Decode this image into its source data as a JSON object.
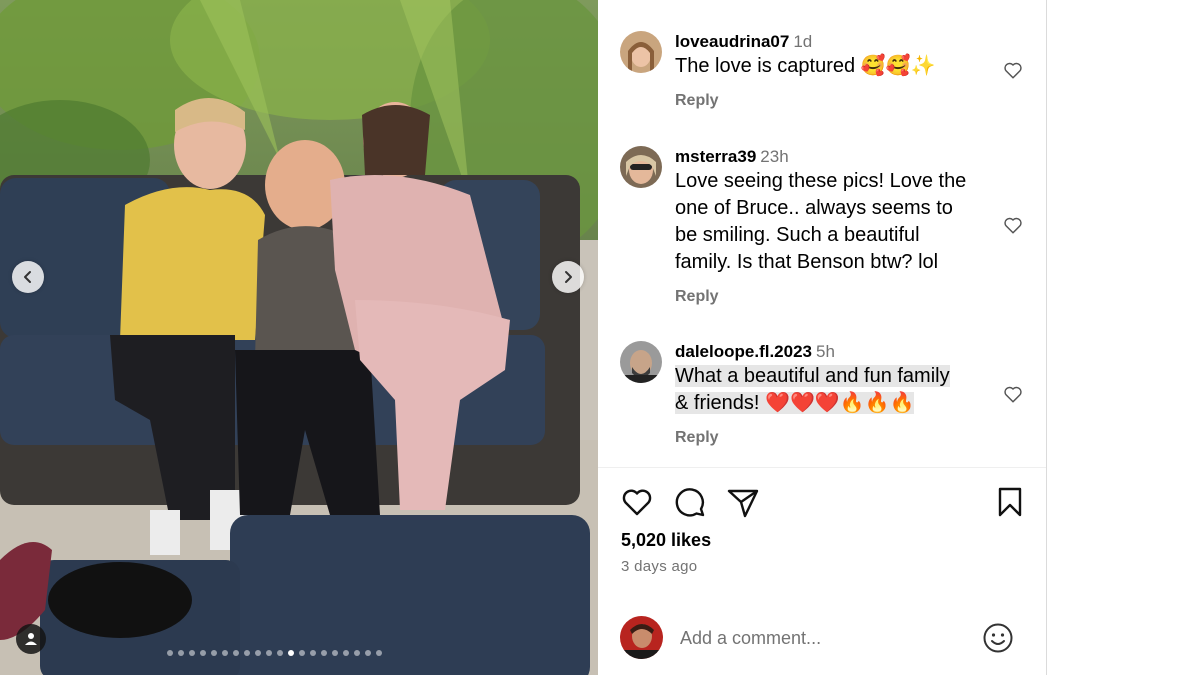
{
  "post": {
    "carousel": {
      "total_slides": 20,
      "current_slide": 11,
      "prev_icon": "chevron-left-icon",
      "next_icon": "chevron-right-icon",
      "tags_icon": "user-icon"
    }
  },
  "comments": [
    {
      "username": "loveaudrina07",
      "time": "1d",
      "text": "The love is captured 🥰🥰✨",
      "reply_label": "Reply",
      "highlighted": false
    },
    {
      "username": "msterra39",
      "time": "23h",
      "text_lines": [
        "Love seeing these pics! Love the",
        "one of Bruce.. always seems to",
        "be smiling. Such a beautiful",
        "family. Is that Benson btw? lol"
      ],
      "reply_label": "Reply",
      "highlighted": false
    },
    {
      "username": "daleloope.fl.2023",
      "time": "5h",
      "text_lines": [
        "What a beautiful and fun family",
        "& friends! ❤️❤️❤️🔥🔥🔥"
      ],
      "reply_label": "Reply",
      "highlighted": true
    }
  ],
  "actions": {
    "like_icon": "heart-icon",
    "comment_icon": "comment-icon",
    "share_icon": "send-icon",
    "save_icon": "bookmark-icon"
  },
  "likes_text": "5,020 likes",
  "posted_ago": "3 days ago",
  "add_comment": {
    "placeholder": "Add a comment...",
    "emoji_icon": "emoji-icon"
  },
  "colors": {
    "secondary_text": "#737373",
    "divider": "#dbdbdb",
    "highlight": "#e6e6e6"
  }
}
